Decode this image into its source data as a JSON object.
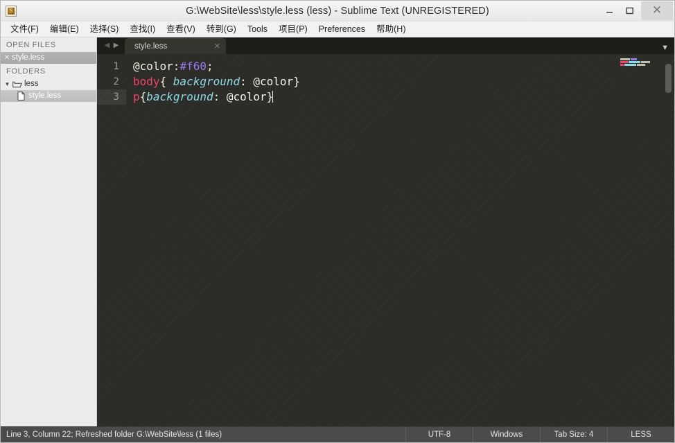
{
  "window": {
    "title": "G:\\WebSite\\less\\style.less (less) - Sublime Text (UNREGISTERED)",
    "app_icon": "sublime-text-icon",
    "minimize_label": "–",
    "maximize_label": "❐",
    "close_label": "✕"
  },
  "menubar": {
    "items": [
      {
        "label": "文件(F)"
      },
      {
        "label": "编辑(E)"
      },
      {
        "label": "选择(S)"
      },
      {
        "label": "查找(I)"
      },
      {
        "label": "查看(V)"
      },
      {
        "label": "转到(G)"
      },
      {
        "label": "Tools"
      },
      {
        "label": "项目(P)"
      },
      {
        "label": "Preferences"
      },
      {
        "label": "帮助(H)"
      }
    ]
  },
  "sidebar": {
    "open_files_label": "OPEN FILES",
    "open_files": [
      {
        "name": "style.less",
        "close": "✕"
      }
    ],
    "folders_label": "FOLDERS",
    "folder": {
      "name": "less",
      "twisty": "▼",
      "icon": "folder-open-icon"
    },
    "folder_files": [
      {
        "name": "style.less",
        "icon": "file-icon"
      }
    ]
  },
  "tabbar": {
    "nav_back": "◀",
    "nav_forward": "▶",
    "dropdown": "▼",
    "tabs": [
      {
        "label": "style.less",
        "close": "✕"
      }
    ]
  },
  "editor": {
    "lines": [
      {
        "number": "1"
      },
      {
        "number": "2"
      },
      {
        "number": "3"
      }
    ],
    "active_line": "3",
    "line1": {
      "var": "@color:",
      "hex": "#f60",
      "semi": ";"
    },
    "line2": {
      "selector": "body",
      "open": "{ ",
      "prop": "background",
      "rest": ": @color}"
    },
    "line3": {
      "selector": "p",
      "open": "{",
      "prop": "background",
      "rest": ": @color}"
    }
  },
  "statusbar": {
    "message": "Line 3, Column 22; Refreshed folder G:\\WebSite\\less (1 files)",
    "encoding": "UTF-8",
    "line_endings": "Windows",
    "tab_size": "Tab Size: 4",
    "syntax": "LESS"
  },
  "colors": {
    "hex_token": "#9b77f2",
    "selector_token": "#ef4369",
    "property_token": "#8fdbe6",
    "editor_bg": "#2b2b26",
    "sidebar_bg": "#ececec",
    "statusbar_bg": "#4b4b4b"
  }
}
